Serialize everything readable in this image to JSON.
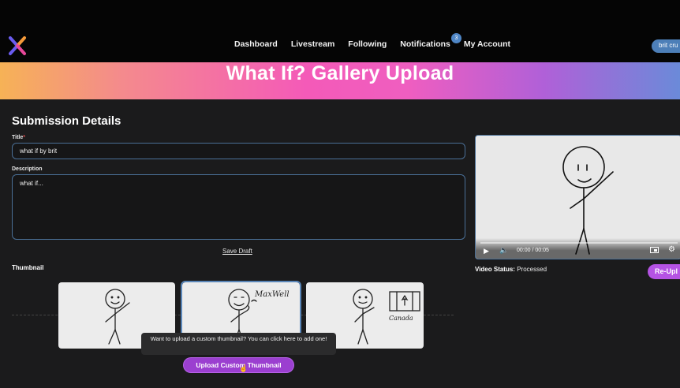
{
  "nav": {
    "items": [
      {
        "label": "Dashboard",
        "name": "nav-dashboard"
      },
      {
        "label": "Livestream",
        "name": "nav-livestream"
      },
      {
        "label": "Following",
        "name": "nav-following"
      },
      {
        "label": "Notifications",
        "name": "nav-notifications"
      },
      {
        "label": "My Account",
        "name": "nav-my-account"
      }
    ],
    "notifications_count": "3",
    "user_label": "brit cru"
  },
  "banner": {
    "title": "What If? Gallery Upload"
  },
  "form": {
    "section_title": "Submission Details",
    "title_label": "Title",
    "title_required": "*",
    "title_value": "what if by brit",
    "description_label": "Description",
    "description_value": "what if...",
    "save_draft": "Save Draft"
  },
  "thumbnail": {
    "label": "Thumbnail",
    "options": [
      {
        "name": "thumbnail-option-1",
        "caption_art": ""
      },
      {
        "name": "thumbnail-option-2",
        "caption_art": "MaxWell"
      },
      {
        "name": "thumbnail-option-3",
        "caption_art": "Canada"
      }
    ],
    "tooltip": "Want to upload a custom thumbnail? You can click here to add one!",
    "upload_button": "Upload Custom Thumbnail"
  },
  "video": {
    "time": "00:00 / 00:05",
    "status_label": "Video Status:",
    "status_value": "Processed",
    "reupload_button": "Re-Upl"
  },
  "colors": {
    "accent_purple": "#9b3fd0",
    "input_border": "#4a6f96",
    "badge_blue": "#4f86c6",
    "panel_bg": "#1b1b1c"
  }
}
